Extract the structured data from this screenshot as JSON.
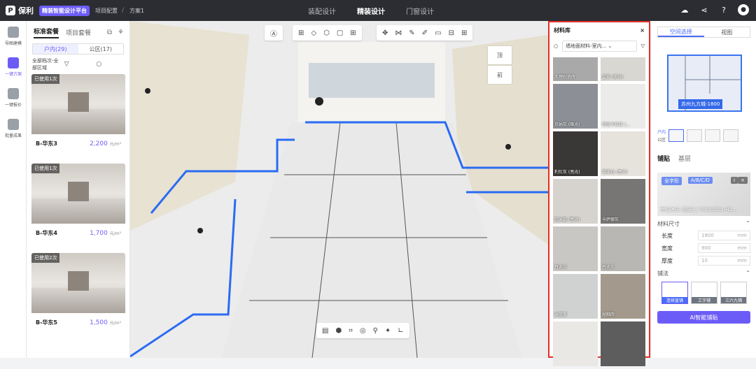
{
  "header": {
    "brand": "保利",
    "badge": "精装智能设计平台",
    "crumbs": [
      "项目配置",
      "方案1"
    ],
    "nav": [
      "装配设计",
      "精装设计",
      "门窗设计"
    ],
    "nav_active": 1
  },
  "rail": {
    "items": [
      {
        "label": "导图建模",
        "icon": "model-icon"
      },
      {
        "label": "一键方案",
        "icon": "magic-icon",
        "active": true
      },
      {
        "label": "一键报价",
        "icon": "price-icon"
      },
      {
        "label": "批量成果",
        "icon": "batch-icon"
      }
    ]
  },
  "list": {
    "tabs": [
      "标准套餐",
      "项目套餐"
    ],
    "seg": [
      "户内(29)",
      "公区(17)"
    ],
    "filter": "全部档次-全部区域",
    "cards": [
      {
        "tag": "已使用1次",
        "name": "B-华东3",
        "price": "2,200",
        "unit": "元/m²"
      },
      {
        "tag": "已使用1次",
        "name": "B-华东4",
        "price": "1,700",
        "unit": "元/m²"
      },
      {
        "tag": "已使用2次",
        "name": "B-华东5",
        "price": "1,500",
        "unit": "元/m²"
      }
    ]
  },
  "viewport": {
    "view_top": "顶",
    "view_front": "前"
  },
  "matlib": {
    "title": "材料库",
    "close": "×",
    "dropdown": "墙地面材料-室内...",
    "tiles": [
      {
        "name": "大理石瓷砖",
        "color": "#a9a9a9"
      },
      {
        "name": "雷雾 (柔光)",
        "color": "#d9d7d2"
      },
      {
        "name": "贝纳灰 (哑光)",
        "color": "#8c9096"
      },
      {
        "name": "特级卡拉拉 (...",
        "color": "#ebebea"
      },
      {
        "name": "利仕灰 (亮光)",
        "color": "#3a3836"
      },
      {
        "name": "赛亚白 (亮光)",
        "color": "#e6e2dc"
      },
      {
        "name": "欧米茄 (亮光)",
        "color": "#d6d3cf"
      },
      {
        "name": "卡萨娜灰",
        "color": "#777674"
      },
      {
        "name": "丹迪灰",
        "color": "#c9c7c4"
      },
      {
        "name": "丹迪灰",
        "color": "#b9b7b3"
      },
      {
        "name": "米蓝斯",
        "color": "#cfd2d0"
      },
      {
        "name": "抛釉砖",
        "color": "#a39a8d"
      },
      {
        "name": "",
        "color": "#e9e8e5"
      },
      {
        "name": "",
        "color": "#5d5d5d"
      }
    ]
  },
  "right": {
    "tabs": [
      "空间选择",
      "视图"
    ],
    "plan_label": "苏州九方城-1800",
    "mini_labels": [
      "户内",
      "公区"
    ],
    "subtabs": [
      "铺贴",
      "基层"
    ],
    "chips": [
      "全字形",
      "A/B/C/D"
    ],
    "material_name": "世纪冰玉 (亮光) | SNQDZ01-HZ...",
    "size_title": "材料尺寸",
    "fields": [
      {
        "label": "长度",
        "value": "1800",
        "unit": "mm"
      },
      {
        "label": "宽度",
        "value": "900",
        "unit": "mm"
      },
      {
        "label": "厚度",
        "value": "10",
        "unit": "mm"
      }
    ],
    "layout_title": "铺法",
    "layouts": [
      "连续直铺",
      "工字铺",
      "三六九铺"
    ],
    "ai_button": "AI智能铺贴"
  }
}
